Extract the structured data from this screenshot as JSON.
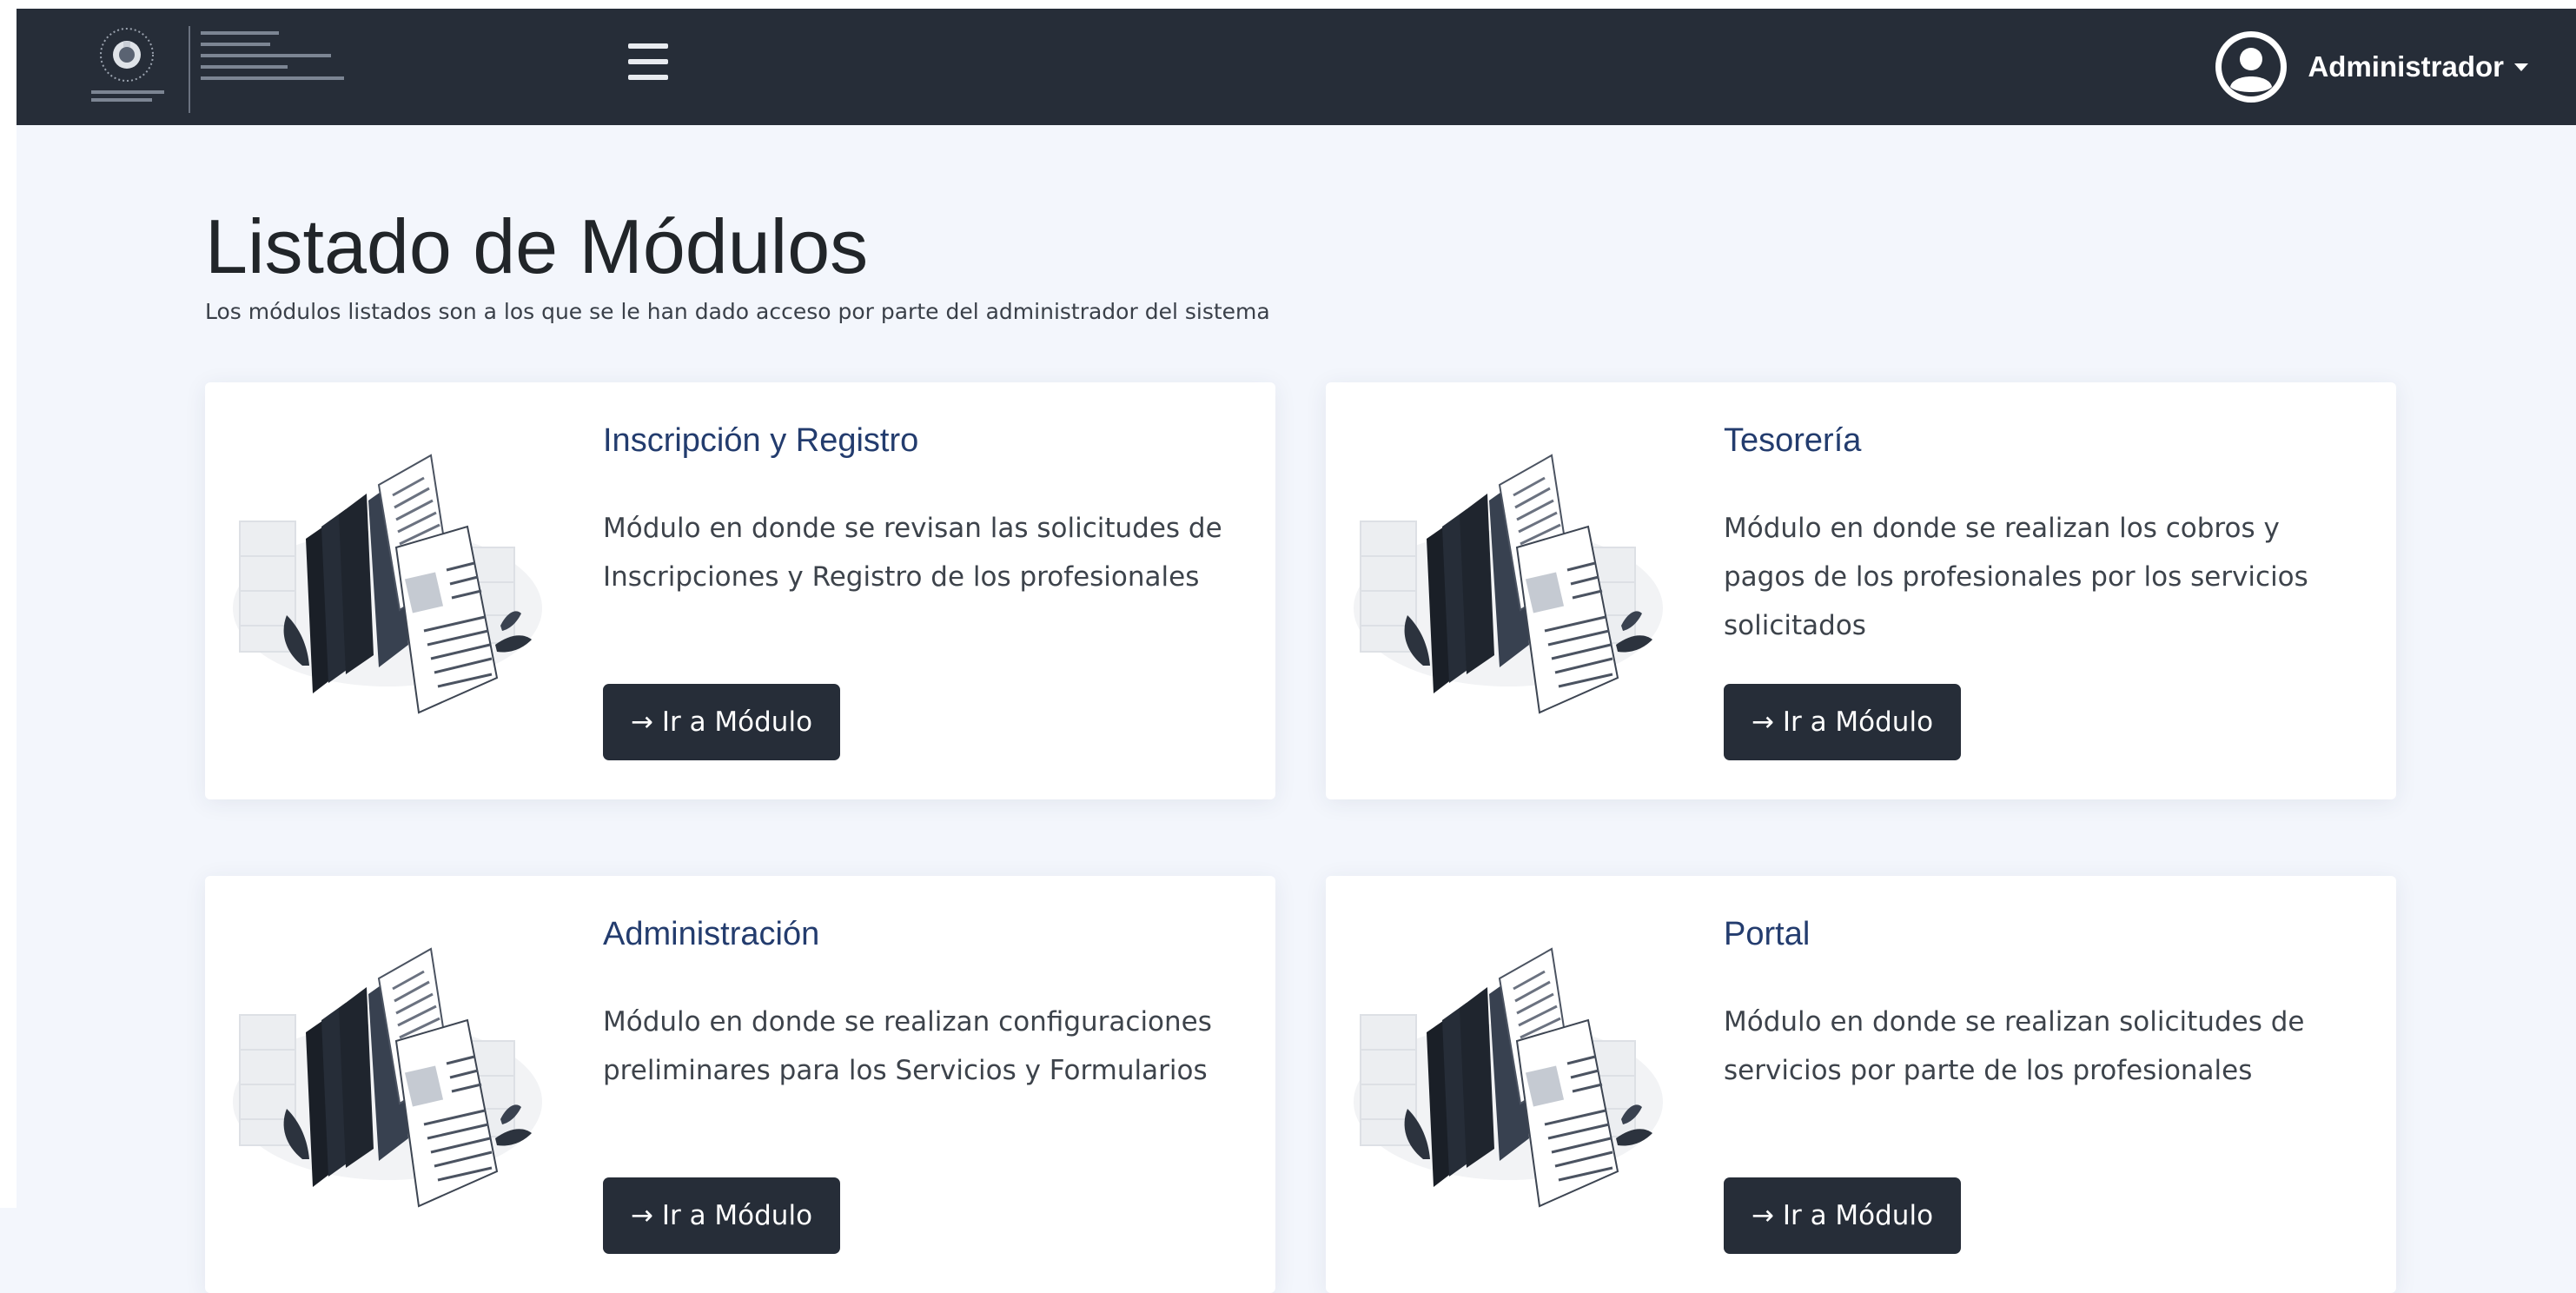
{
  "header": {
    "user_name": "Administrador"
  },
  "page": {
    "title": "Listado de Módulos",
    "subtitle": "Los módulos listados son a los que se le han dado acceso por parte del administrador del sistema"
  },
  "modules": [
    {
      "title": "Inscripción y Registro",
      "description": "Módulo en donde se revisan las solicitudes de Inscripciones y Registro de los profesionales",
      "button_label": "→ Ir a Módulo"
    },
    {
      "title": "Tesorería",
      "description": "Módulo en donde se realizan los cobros y pagos de los profesionales por los servicios solicitados",
      "button_label": "→ Ir a Módulo"
    },
    {
      "title": "Administración",
      "description": "Módulo en donde se realizan configuraciones preliminares para los Servicios y Formularios",
      "button_label": "→ Ir a Módulo"
    },
    {
      "title": "Portal",
      "description": "Módulo en donde se realizan solicitudes de servicios por parte de los profesionales",
      "button_label": "→ Ir a Módulo"
    }
  ],
  "colors": {
    "navbar": "#262d38",
    "page_background": "#f3f6fc",
    "card_title": "#233c6e",
    "button": "#262d38"
  },
  "icons": {
    "menu": "hamburger-menu-icon",
    "user": "user-avatar-icon",
    "dropdown": "caret-down-icon",
    "module_illustration": "documents-folders-illustration"
  }
}
